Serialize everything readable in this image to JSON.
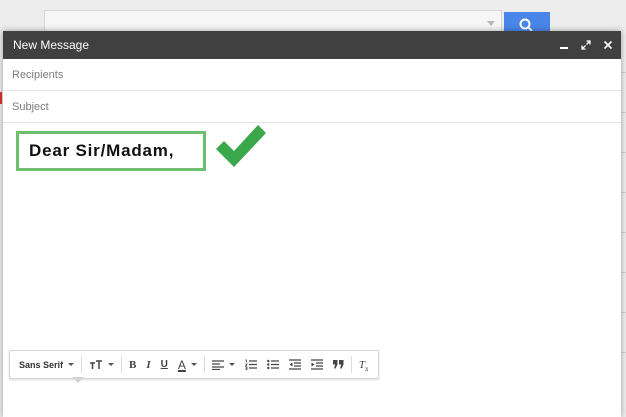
{
  "window": {
    "title": "New Message",
    "controls": [
      "minimize-icon",
      "expand-icon",
      "close-icon"
    ]
  },
  "fields": {
    "recipients_placeholder": "Recipients",
    "subject_placeholder": "Subject"
  },
  "body": {
    "greeting": "Dear Sir/Madam,",
    "annotation_icon": "checkmark-icon",
    "highlight_color": "#6dbf6f",
    "check_color": "#3aa84a"
  },
  "toolbar": {
    "font_label": "Sans Serif",
    "bold_label": "B",
    "italic_label": "I",
    "underline_label": "U",
    "text_color_label": "A",
    "clear_format_label": "T",
    "icons": [
      "text-size-icon",
      "bold-icon",
      "italic-icon",
      "underline-icon",
      "text-color-icon",
      "align-icon",
      "numbered-list-icon",
      "bulleted-list-icon",
      "indent-less-icon",
      "indent-more-icon",
      "quote-icon",
      "clear-formatting-icon"
    ]
  },
  "colors": {
    "titlebar": "#404040",
    "search_button": "#4a86e8"
  }
}
